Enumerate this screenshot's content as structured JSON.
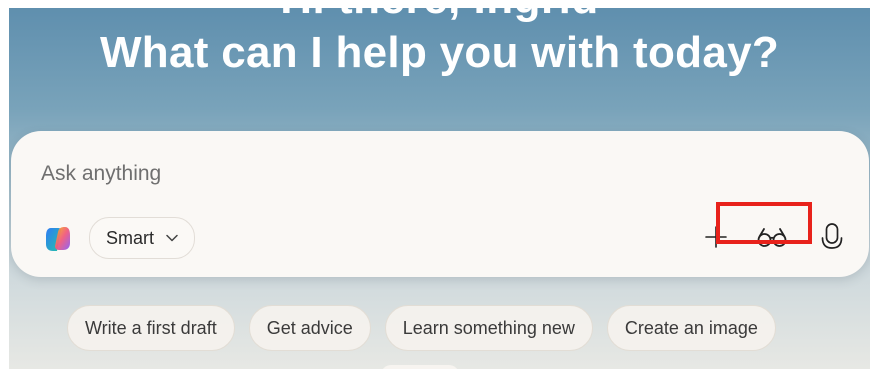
{
  "header": {
    "greeting_fragment": "Hi there, Ingrid",
    "headline": "What can I help you with today?"
  },
  "composer": {
    "placeholder": "Ask anything",
    "mode": "Smart",
    "icons": [
      "copilot-logo",
      "chevron-down-icon",
      "plus-icon",
      "glasses-icon",
      "microphone-icon"
    ]
  },
  "suggestions": [
    {
      "label": "Write a first draft"
    },
    {
      "label": "Get advice"
    },
    {
      "label": "Learn something new"
    },
    {
      "label": "Create an image"
    }
  ],
  "colors": {
    "highlight": "#e8221b",
    "background_top": "#5f8fae",
    "background_bottom": "#e7e8e4",
    "composer_bg": "#faf8f5"
  }
}
